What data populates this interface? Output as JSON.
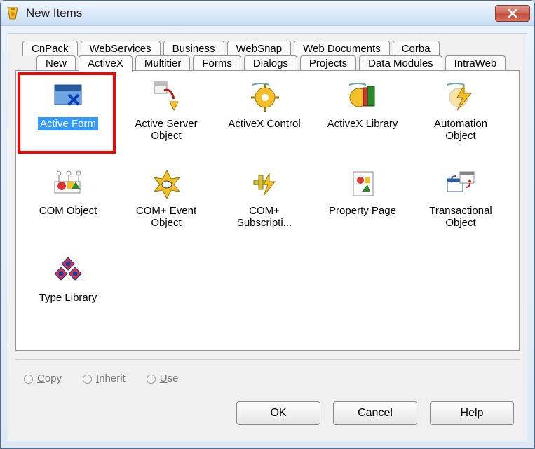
{
  "window": {
    "title": "New Items"
  },
  "tabs_row1": [
    {
      "label": "CnPack"
    },
    {
      "label": "WebServices"
    },
    {
      "label": "Business"
    },
    {
      "label": "WebSnap"
    },
    {
      "label": "Web Documents"
    },
    {
      "label": "Corba"
    }
  ],
  "tabs_row2": [
    {
      "label": "New"
    },
    {
      "label": "ActiveX",
      "active": true
    },
    {
      "label": "Multitier"
    },
    {
      "label": "Forms"
    },
    {
      "label": "Dialogs"
    },
    {
      "label": "Projects"
    },
    {
      "label": "Data Modules"
    },
    {
      "label": "IntraWeb"
    }
  ],
  "items": [
    {
      "label": "Active Form",
      "icon": "form-x",
      "selected": true,
      "highlighted": true
    },
    {
      "label": "Active Server Object",
      "icon": "box-arrow"
    },
    {
      "label": "ActiveX Control",
      "icon": "gear-gold"
    },
    {
      "label": "ActiveX Library",
      "icon": "books-gold"
    },
    {
      "label": "Automation Object",
      "icon": "bolt-gold"
    },
    {
      "label": "COM Object",
      "icon": "shapes"
    },
    {
      "label": "COM+ Event Object",
      "icon": "gear-burst"
    },
    {
      "label": "COM+ Subscripti...",
      "icon": "plus-bolt"
    },
    {
      "label": "Property Page",
      "icon": "shapes-page"
    },
    {
      "label": "Transactional Object",
      "icon": "windows-swap"
    },
    {
      "label": "Type Library",
      "icon": "diamonds"
    }
  ],
  "radios": {
    "copy": "Copy",
    "inherit": "Inherit",
    "use": "Use"
  },
  "buttons": {
    "ok": "OK",
    "cancel": "Cancel",
    "help": "Help"
  }
}
